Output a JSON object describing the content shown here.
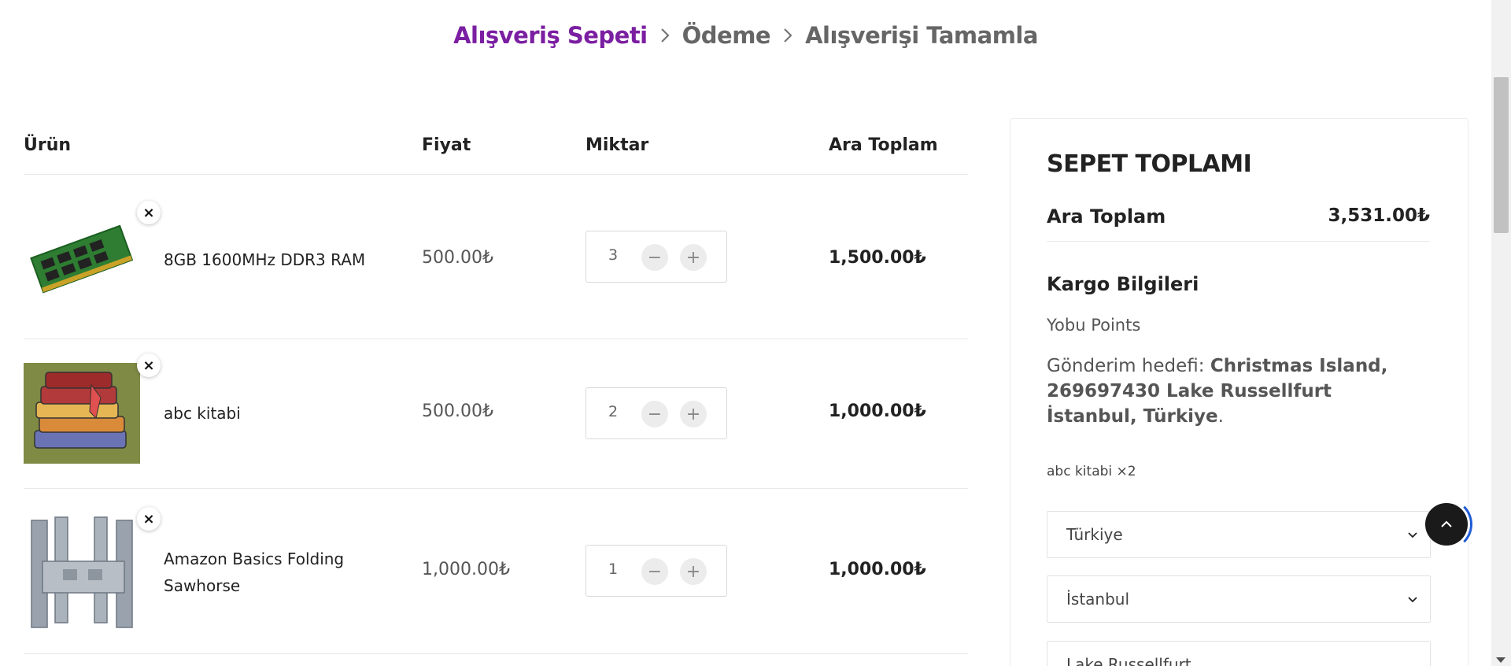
{
  "steps": {
    "cart": "Alışveriş Sepeti",
    "checkout": "Ödeme",
    "complete": "Alışverişi Tamamla"
  },
  "cart": {
    "headers": {
      "product": "Ürün",
      "price": "Fiyat",
      "quantity": "Miktar",
      "subtotal": "Ara Toplam"
    },
    "remove_symbol": "×",
    "minus_symbol": "−",
    "plus_symbol": "+",
    "items": [
      {
        "name": "8GB 1600MHz DDR3 RAM",
        "price": "500.00₺",
        "quantity": "3",
        "subtotal": "1,500.00₺",
        "image": "ram-module-image"
      },
      {
        "name": "abc kitabi",
        "price": "500.00₺",
        "quantity": "2",
        "subtotal": "1,000.00₺",
        "image": "books-stack-image"
      },
      {
        "name_line1": "Amazon Basics Folding",
        "name_line2": "Sawhorse",
        "price": "1,000.00₺",
        "quantity": "1",
        "subtotal": "1,000.00₺",
        "image": "sawhorse-image"
      }
    ]
  },
  "summary": {
    "title": "SEPET TOPLAMI",
    "subtotal_label": "Ara Toplam",
    "subtotal_value": "3,531.00₺",
    "shipping_title": "Kargo Bilgileri",
    "shipping_method": "Yobu Points",
    "destination_prefix": "Gönderim hedefi: ",
    "destination_value": "Christmas Island, 269697430 Lake Russellfurt İstanbul, Türkiye",
    "destination_suffix": ".",
    "shipping_items": "abc kitabi ×2",
    "country": "Türkiye",
    "city": "İstanbul",
    "street": "Lake Russellfurt"
  },
  "colors": {
    "accent": "#7b1fa2",
    "scroll_ring": "#1e5bd6"
  },
  "icons": {
    "step_separator": "chevron-right-icon",
    "select_chevron": "chevron-down-icon",
    "to_top": "chevron-up-icon"
  }
}
